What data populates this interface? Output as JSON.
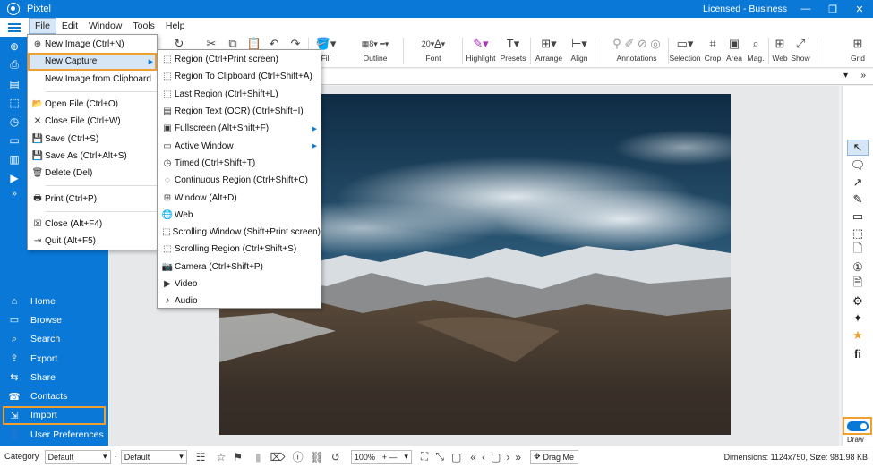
{
  "app": {
    "title": "Pixtel",
    "license": "Licensed - Business",
    "window_buttons": [
      "—",
      "❐",
      "✕"
    ]
  },
  "menubar": [
    "File",
    "Edit",
    "Window",
    "Tools",
    "Help"
  ],
  "toolbar": {
    "groups": [
      "Fill",
      "Outline",
      "Font",
      "Highlight",
      "Presets",
      "Arrange",
      "Align",
      "Annotations",
      "Selection",
      "Crop",
      "Area",
      "Mag.",
      "Web",
      "Show",
      "Grid"
    ],
    "outline_width": "8",
    "font_size": "20"
  },
  "file_menu": {
    "items": [
      {
        "icon": "⊕",
        "label": "New Image (Ctrl+N)"
      },
      {
        "icon": "",
        "label": "New Capture",
        "submenu": true,
        "highlight": true
      },
      {
        "icon": "",
        "label": "New Image from Clipboard"
      },
      {
        "sep": true
      },
      {
        "icon": "📂",
        "label": "Open File (Ctrl+O)"
      },
      {
        "icon": "✕",
        "label": "Close File (Ctrl+W)"
      },
      {
        "icon": "💾",
        "label": "Save (Ctrl+S)"
      },
      {
        "icon": "💾",
        "label": "Save As (Ctrl+Alt+S)"
      },
      {
        "icon": "🗑",
        "label": "Delete (Del)"
      },
      {
        "sep": true
      },
      {
        "icon": "🖶",
        "label": "Print (Ctrl+P)"
      },
      {
        "sep": true
      },
      {
        "icon": "☒",
        "label": "Close (Alt+F4)"
      },
      {
        "icon": "⇥",
        "label": "Quit (Alt+F5)"
      }
    ]
  },
  "capture_menu": {
    "items": [
      {
        "icon": "⬚",
        "label": "Region (Ctrl+Print screen)"
      },
      {
        "icon": "⬚",
        "label": "Region To Clipboard (Ctrl+Shift+A)"
      },
      {
        "icon": "⬚",
        "label": "Last Region (Ctrl+Shift+L)"
      },
      {
        "icon": "▤",
        "label": "Region Text (OCR) (Ctrl+Shift+I)"
      },
      {
        "icon": "▣",
        "label": "Fullscreen (Alt+Shift+F)",
        "submenu": true
      },
      {
        "icon": "▭",
        "label": "Active Window",
        "submenu": true
      },
      {
        "icon": "◷",
        "label": "Timed (Ctrl+Shift+T)"
      },
      {
        "icon": "◌",
        "label": "Continuous Region (Ctrl+Shift+C)"
      },
      {
        "icon": "⊞",
        "label": "Window (Alt+D)"
      },
      {
        "icon": "🌐",
        "label": "Web"
      },
      {
        "icon": "⬚",
        "label": "Scrolling Window (Shift+Print screen)"
      },
      {
        "icon": "⬚",
        "label": "Scrolling Region (Ctrl+Shift+S)"
      },
      {
        "icon": "📷",
        "label": "Camera (Ctrl+Shift+P)"
      },
      {
        "icon": "▶",
        "label": "Video"
      },
      {
        "icon": "♪",
        "label": "Audio"
      }
    ]
  },
  "sidebar_nav": [
    {
      "icon": "⌂",
      "label": "Home"
    },
    {
      "icon": "▭",
      "label": "Browse"
    },
    {
      "icon": "⌕",
      "label": "Search"
    },
    {
      "icon": "⇪",
      "label": "Export"
    },
    {
      "icon": "⇆",
      "label": "Share"
    },
    {
      "icon": "☎",
      "label": "Contacts"
    },
    {
      "icon": "⇲",
      "label": "Import",
      "highlight": true
    },
    {
      "icon": "👤",
      "label": "User Preferences"
    }
  ],
  "right_tools": {
    "draw_label": "Draw"
  },
  "bottombar": {
    "category_label": "Category",
    "category_value": "Default",
    "second_value": "Default",
    "zoom": "100%",
    "drag_label": "Drag Me",
    "dimensions": "Dimensions: 1124x750, Size: 981.98 KB"
  }
}
